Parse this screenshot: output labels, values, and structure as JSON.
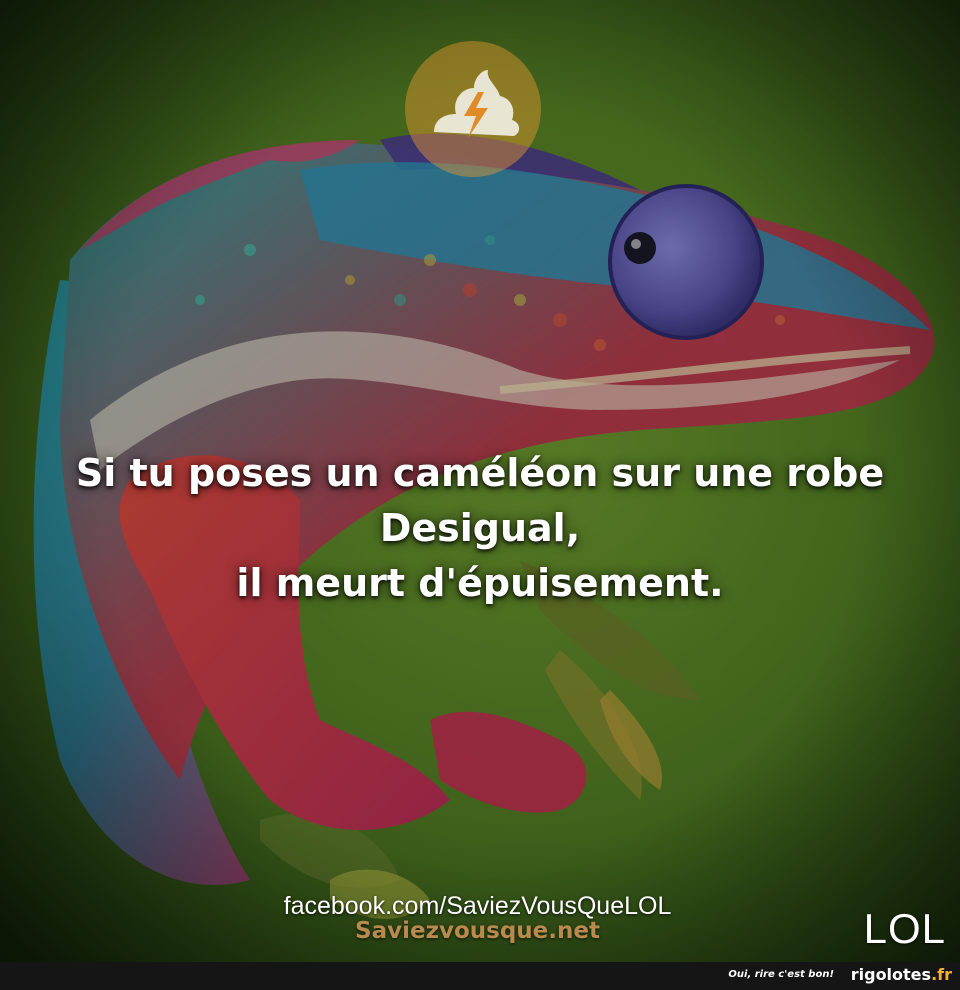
{
  "caption": {
    "line1": "Si tu poses un caméléon sur une robe",
    "line2": "Desigual,",
    "line3": "il meurt d'épuisement."
  },
  "watermarks": {
    "facebook": "facebook.com/SaviezVousQueLOL",
    "site": "Saviezvousque.net",
    "lol": "LOL",
    "logo_icon": "lightning-swirl-icon"
  },
  "footer": {
    "tagline": "Oui, rire c'est bon!",
    "brand_name": "rigolotes",
    "brand_tld": ".fr"
  },
  "colors": {
    "background_green": "#5f8a2c",
    "accent_orange": "#f2b22a",
    "site_brown": "#b88a4d",
    "footer_bar": "#151515"
  }
}
